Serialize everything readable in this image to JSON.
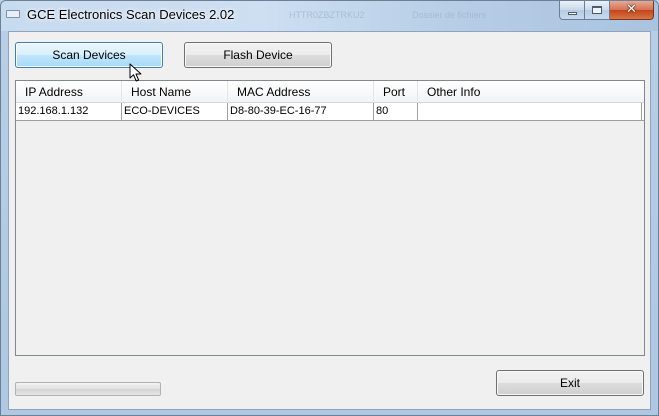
{
  "window": {
    "title": "GCE Electronics Scan Devices 2.02",
    "background_ghost_1": "HTTR0ZBZTRKU2",
    "background_ghost_2": "Dossier de fichiers",
    "close_glyph": "✕"
  },
  "toolbar": {
    "scan_label": "Scan Devices",
    "flash_label": "Flash Device"
  },
  "table": {
    "columns": [
      "IP Address",
      "Host Name",
      "MAC Address",
      "Port",
      "Other Info"
    ],
    "rows": [
      [
        "192.168.1.132",
        "ECO-DEVICES",
        "D8-80-39-EC-16-77",
        "80",
        ""
      ]
    ]
  },
  "progress": {
    "value": 0
  },
  "footer": {
    "exit_label": "Exit"
  },
  "colors": {
    "accent_hover": "#bee6fd",
    "window_frame": "#b9d1ea",
    "close_button": "#c4431f"
  },
  "icons": [
    "app-icon",
    "minimize-icon",
    "maximize-icon",
    "close-icon",
    "mouse-pointer-icon"
  ]
}
